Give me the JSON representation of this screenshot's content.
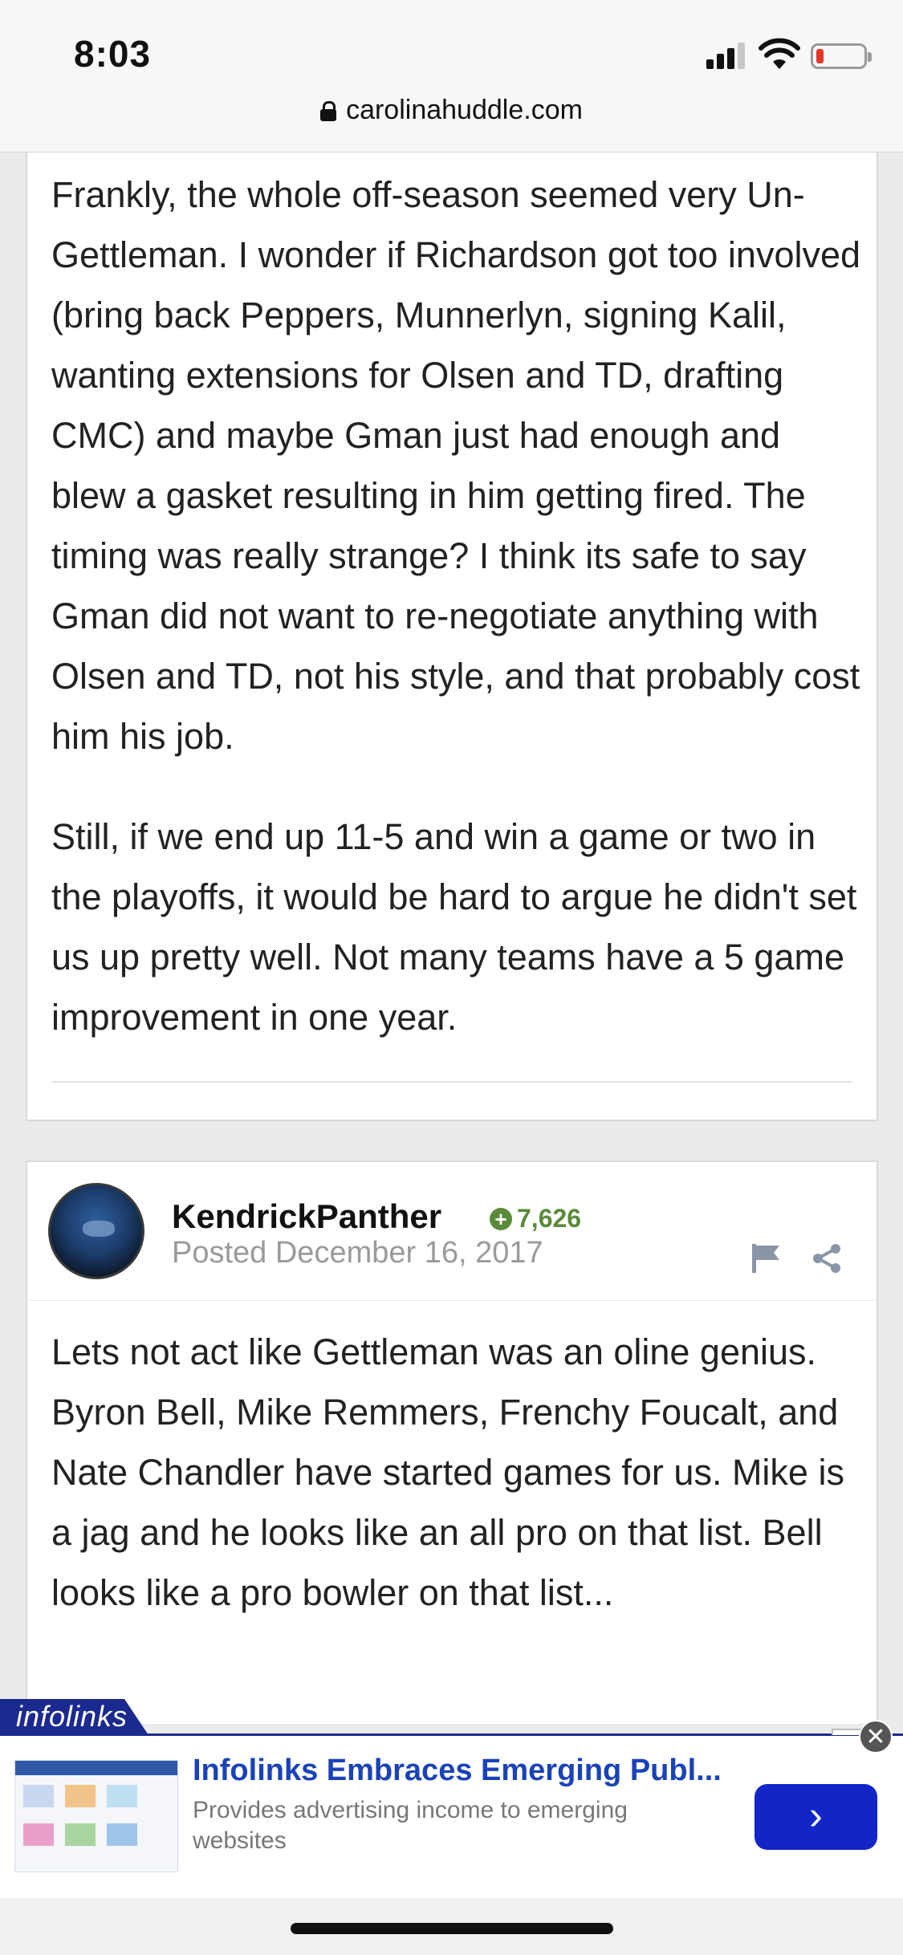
{
  "status_bar": {
    "time": "8:03"
  },
  "browser": {
    "url": "carolinahuddle.com"
  },
  "post1": {
    "paragraph1": "Frankly, the whole off-season seemed very Un-Gettleman.  I wonder if Richardson got too involved (bring back Peppers, Munnerlyn, signing Kalil, wanting extensions for Olsen and TD, drafting CMC) and maybe Gman just had enough and blew a gasket resulting in him getting fired.  The timing was really strange?  I think its safe to say Gman did not want to re-negotiate anything with Olsen and TD, not his style, and that probably cost him his job.",
    "paragraph2": "Still, if we end up 11-5 and win a game or two in the playoffs, it would be hard to argue he didn't set us up pretty well.  Not many teams have a 5 game improvement in one year."
  },
  "post2": {
    "username": "KendrickPanther",
    "reputation": "7,626",
    "posted": "Posted December 16, 2017",
    "text": "Lets not act like Gettleman was an oline genius. Byron Bell, Mike Remmers, Frenchy Foucalt, and Nate Chandler have started games for us. Mike is a jag and he looks like an all pro on that list. Bell looks like a pro bowler on that list..."
  },
  "ad": {
    "brand": "infolinks",
    "title": "Infolinks Embraces Emerging Publ...",
    "description": "Provides advertising income to emerging websites",
    "button_glyph": "›",
    "close_glyph": "✕"
  },
  "colors": {
    "accent_blue": "#1a43b8",
    "button_blue": "#1325c6",
    "reputation_green": "#5a8a3a",
    "battery_low": "#e0362c"
  }
}
